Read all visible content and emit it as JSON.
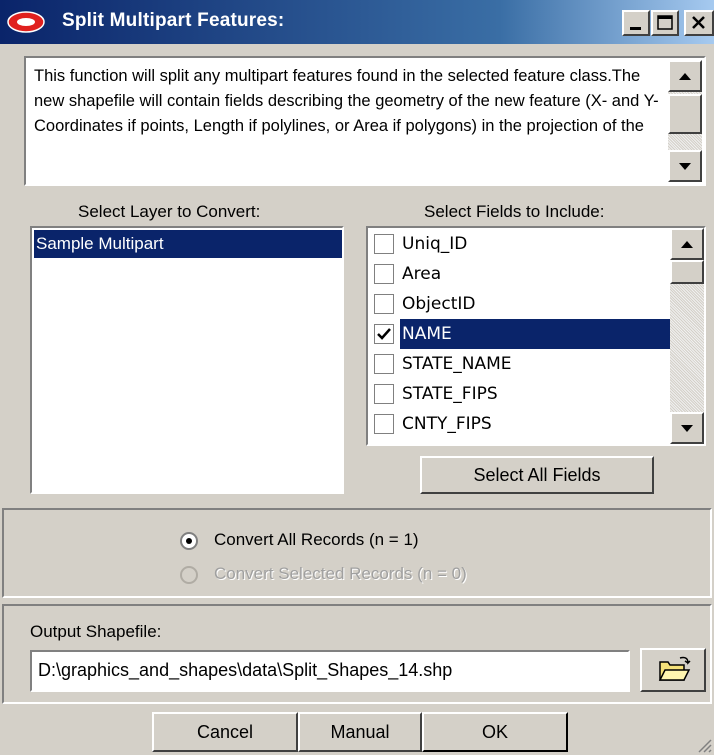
{
  "window": {
    "title": "Split Multipart Features:",
    "icon": "red-diamond-icon"
  },
  "description": "This function will split any multipart features found in the selected feature class.The new shapefile will contain fields describing the geometry of the new feature (X- and Y-Coordinates if points, Length if polylines, or Area if polygons) in the projection of the",
  "layers": {
    "label": "Select Layer to Convert:",
    "items": [
      "Sample Multipart"
    ],
    "selected": "Sample Multipart"
  },
  "fields": {
    "label": "Select Fields to Include:",
    "items": [
      {
        "name": "Uniq_ID",
        "checked": false
      },
      {
        "name": "Area",
        "checked": false
      },
      {
        "name": "ObjectID",
        "checked": false
      },
      {
        "name": "NAME",
        "checked": true
      },
      {
        "name": "STATE_NAME",
        "checked": false
      },
      {
        "name": "STATE_FIPS",
        "checked": false
      },
      {
        "name": "CNTY_FIPS",
        "checked": false
      }
    ],
    "select_all_label": "Select All Fields"
  },
  "records": {
    "all_label": "Convert All Records (n = 1)",
    "selected_label": "Convert Selected Records (n = 0)",
    "choice": "all"
  },
  "output": {
    "label": "Output Shapefile:",
    "value": "D:\\graphics_and_shapes\\data\\Split_Shapes_14.shp",
    "browse_icon": "open-folder-icon"
  },
  "buttons": {
    "cancel": "Cancel",
    "manual": "Manual",
    "ok": "OK"
  },
  "colors": {
    "face": "#d4d0c8",
    "selection": "#0a246a",
    "titlebar": "#0a246a"
  }
}
